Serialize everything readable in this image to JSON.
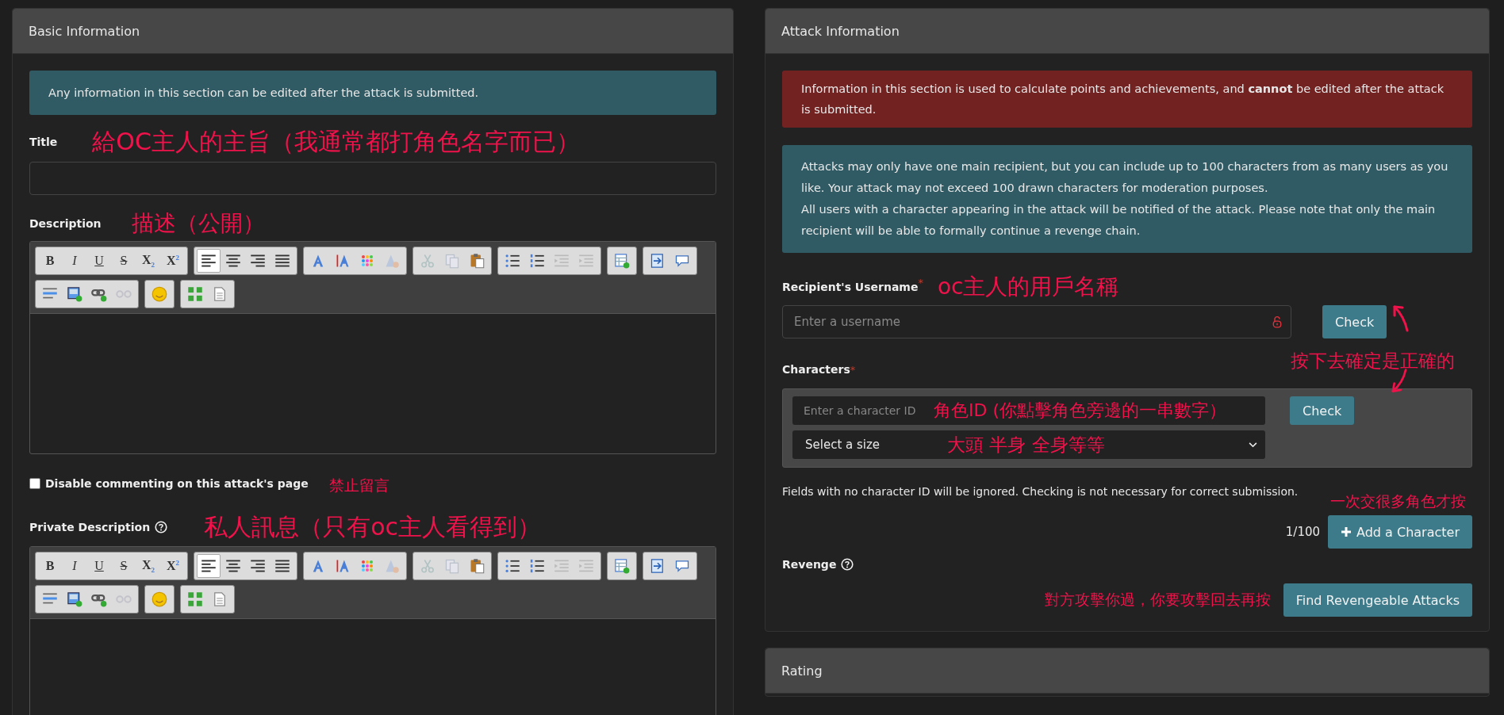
{
  "basic": {
    "header": "Basic Information",
    "info": "Any information in this section can be edited after the attack is submitted.",
    "title_field": {
      "label": "Title",
      "note": "給OC主人的主旨（我通常都打角色名字而已）"
    },
    "description": {
      "label": "Description",
      "note": "描述（公開）",
      "toolbar": [
        [
          {
            "kind": "bold",
            "label": "B",
            "on": false,
            "disabled": false
          },
          {
            "kind": "italic",
            "label": "I",
            "on": false,
            "disabled": false
          },
          {
            "kind": "underline",
            "label": "U",
            "on": false,
            "disabled": false
          },
          {
            "kind": "strike",
            "label": "S",
            "on": false,
            "disabled": false
          },
          {
            "kind": "subscript",
            "label": "X$_{2}$",
            "on": false,
            "disabled": false
          },
          {
            "kind": "superscript",
            "label": "X$^{2}$",
            "on": false,
            "disabled": false
          }
        ],
        [
          {
            "kind": "align-left",
            "on": true,
            "disabled": false
          },
          {
            "kind": "align-center",
            "on": false,
            "disabled": false
          },
          {
            "kind": "align-right",
            "on": false,
            "disabled": false
          },
          {
            "kind": "justify",
            "on": false,
            "disabled": false
          }
        ],
        [
          {
            "kind": "text-color",
            "on": false,
            "disabled": false
          },
          {
            "kind": "text-size",
            "on": false,
            "disabled": false
          },
          {
            "kind": "palette",
            "on": false,
            "disabled": false
          },
          {
            "kind": "remove-format",
            "on": false,
            "disabled": true
          }
        ],
        [
          {
            "kind": "cut",
            "on": false,
            "disabled": true
          },
          {
            "kind": "copy",
            "on": false,
            "disabled": true
          },
          {
            "kind": "paste",
            "on": false,
            "disabled": false
          }
        ],
        [
          {
            "kind": "bullets",
            "on": false,
            "disabled": false
          },
          {
            "kind": "numbers",
            "on": false,
            "disabled": false
          },
          {
            "kind": "outdent",
            "on": false,
            "disabled": true
          },
          {
            "kind": "indent",
            "on": false,
            "disabled": true
          }
        ],
        [
          {
            "kind": "table",
            "on": false,
            "disabled": false
          }
        ],
        [
          {
            "kind": "source",
            "on": false,
            "disabled": false
          },
          {
            "kind": "comment",
            "on": false,
            "disabled": false
          }
        ],
        [
          {
            "kind": "rule",
            "on": false,
            "disabled": false
          },
          {
            "kind": "image",
            "on": false,
            "disabled": false
          },
          {
            "kind": "link",
            "on": false,
            "disabled": false
          },
          {
            "kind": "unlink",
            "on": false,
            "disabled": true
          }
        ],
        [
          {
            "kind": "smiley",
            "on": false,
            "disabled": false
          }
        ],
        [
          {
            "kind": "blocks",
            "on": false,
            "disabled": false
          },
          {
            "kind": "page",
            "on": false,
            "disabled": false
          }
        ]
      ]
    },
    "disable_comments": {
      "label": "Disable commenting on this attack's page",
      "checked": false,
      "note": "禁止留言"
    },
    "private_description": {
      "label": "Private Description",
      "note": "私人訊息（只有oc主人看得到）",
      "toolbar": [
        [
          {
            "kind": "bold",
            "label": "B",
            "on": false,
            "disabled": false
          },
          {
            "kind": "italic",
            "label": "I",
            "on": false,
            "disabled": false
          },
          {
            "kind": "underline",
            "label": "U",
            "on": false,
            "disabled": false
          },
          {
            "kind": "strike",
            "label": "S",
            "on": false,
            "disabled": false
          },
          {
            "kind": "subscript",
            "label": "X$_{2}$",
            "on": false,
            "disabled": false
          },
          {
            "kind": "superscript",
            "label": "X$^{2}$",
            "on": false,
            "disabled": false
          }
        ],
        [
          {
            "kind": "align-left",
            "on": true,
            "disabled": false
          },
          {
            "kind": "align-center",
            "on": false,
            "disabled": false
          },
          {
            "kind": "align-right",
            "on": false,
            "disabled": false
          },
          {
            "kind": "justify",
            "on": false,
            "disabled": false
          }
        ],
        [
          {
            "kind": "text-color",
            "on": false,
            "disabled": false
          },
          {
            "kind": "text-size",
            "on": false,
            "disabled": false
          },
          {
            "kind": "palette",
            "on": false,
            "disabled": false
          },
          {
            "kind": "remove-format",
            "on": false,
            "disabled": true
          }
        ],
        [
          {
            "kind": "cut",
            "on": false,
            "disabled": true
          },
          {
            "kind": "copy",
            "on": false,
            "disabled": true
          },
          {
            "kind": "paste",
            "on": false,
            "disabled": false
          }
        ],
        [
          {
            "kind": "bullets",
            "on": false,
            "disabled": false
          },
          {
            "kind": "numbers",
            "on": false,
            "disabled": false
          },
          {
            "kind": "outdent",
            "on": false,
            "disabled": true
          },
          {
            "kind": "indent",
            "on": false,
            "disabled": true
          }
        ],
        [
          {
            "kind": "table",
            "on": false,
            "disabled": false
          }
        ],
        [
          {
            "kind": "source",
            "on": false,
            "disabled": false
          },
          {
            "kind": "comment",
            "on": false,
            "disabled": false
          }
        ],
        [
          {
            "kind": "rule",
            "on": false,
            "disabled": false
          },
          {
            "kind": "image",
            "on": false,
            "disabled": false
          },
          {
            "kind": "link",
            "on": false,
            "disabled": false
          },
          {
            "kind": "unlink",
            "on": false,
            "disabled": true
          }
        ],
        [
          {
            "kind": "smiley",
            "on": false,
            "disabled": false
          }
        ],
        [
          {
            "kind": "blocks",
            "on": false,
            "disabled": false
          },
          {
            "kind": "page",
            "on": false,
            "disabled": false
          }
        ]
      ]
    }
  },
  "attack": {
    "header": "Attack Information",
    "warning": "Information in this section is used to calculate points and achievements, and **cannot** be edited after the attack is submitted.",
    "info": [
      "Attacks may only have one main recipient, but you can include up to 100 characters from as many users as you like. Your attack may not exceed 100 drawn characters for moderation purposes.",
      "All users with a character appearing in the attack will be notified of the attack. Please note that only the main recipient will be able to formally continue a revenge chain."
    ],
    "recipient": {
      "label": "Recipient's Username",
      "required": "*",
      "placeholder": "Enter a username",
      "button": "Check",
      "note": "oc主人的用戶名稱"
    },
    "check_note": "按下去確定是正確的",
    "characters": {
      "label": "Characters",
      "required": "*",
      "rows": [
        {
          "placeholder": "Enter a character ID",
          "button": "Check",
          "id_note": "角色ID (你點擊角色旁邊的一串數字）",
          "size": "Select a size",
          "size_note": "大頭  半身  全身等等"
        }
      ]
    },
    "fields_hint": "Fields with no character ID will be ignored. Checking is not necessary for correct submission.",
    "count": "1/100",
    "add_button": "Add a Character",
    "add_note": "一次交很多角色才按",
    "revenge": {
      "label": "Revenge",
      "button": "Find Revengeable Attacks",
      "note": "對方攻擊你過，你要攻擊回去再按"
    }
  },
  "rating": {
    "header": "Rating"
  }
}
